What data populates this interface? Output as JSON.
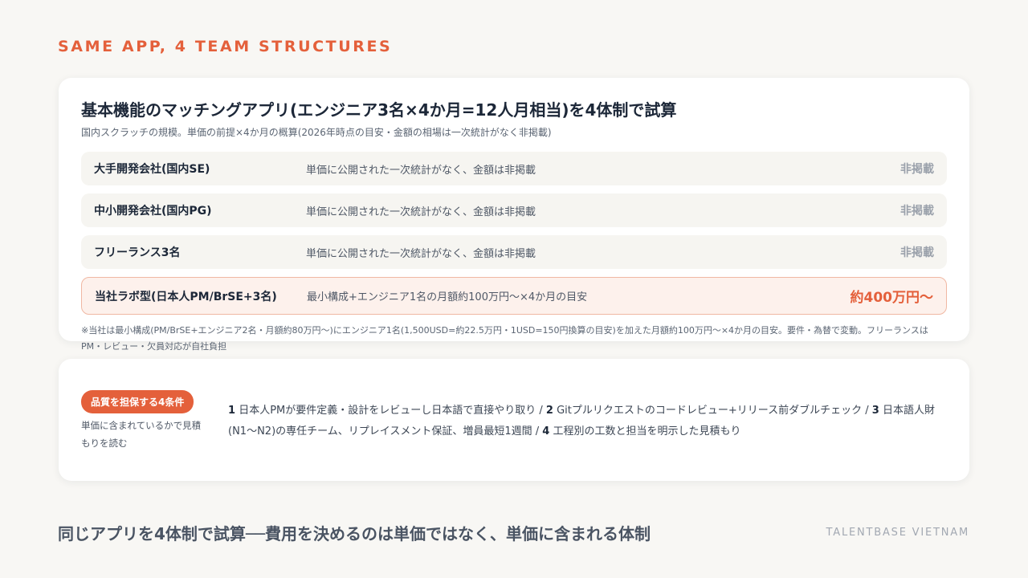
{
  "eyebrow": "SAME APP, 4 TEAM STRUCTURES",
  "main": {
    "title": "基本機能のマッチングアプリ(エンジニア3名×4か月=12人月相当)を4体制で試算",
    "subtitle": "国内スクラッチの規模。単価の前提×4か月の概算(2026年時点の目安・金額の相場は一次統計がなく非掲載)",
    "rows": [
      {
        "name": "大手開発会社(国内SE)",
        "desc": "単価に公開された一次統計がなく、金額は非掲載",
        "value": "非掲載"
      },
      {
        "name": "中小開発会社(国内PG)",
        "desc": "単価に公開された一次統計がなく、金額は非掲載",
        "value": "非掲載"
      },
      {
        "name": "フリーランス3名",
        "desc": "単価に公開された一次統計がなく、金額は非掲載",
        "value": "非掲載"
      },
      {
        "name": "当社ラボ型(日本人PM/BrSE+3名)",
        "desc": "最小構成+エンジニア1名の月額約100万円〜×4か月の目安",
        "value": "約400万円〜"
      }
    ],
    "footnote": "※当社は最小構成(PM/BrSE+エンジニア2名・月額約80万円〜)にエンジニア1名(1,500USD=約22.5万円・1USD=150円換算の目安)を加えた月額約100万円〜×4か月の目安。要件・為替で変動。フリーランスはPM・レビュー・欠員対応が自社負担"
  },
  "quality": {
    "badge": "品質を担保する4条件",
    "note": "単価に含まれているかで見積もりを読む",
    "conditions": [
      {
        "num": "1",
        "text": "日本人PMが要件定義・設計をレビューし日本語で直接やり取り"
      },
      {
        "num": "2",
        "text": "Gitプルリクエストのコードレビュー+リリース前ダブルチェック"
      },
      {
        "num": "3",
        "text": "日本語人財(N1〜N2)の専任チーム、リプレイスメント保証、増員最短1週間"
      },
      {
        "num": "4",
        "text": "工程別の工数と担当を明示した見積もり"
      }
    ],
    "separator": " / "
  },
  "footer": {
    "title": "同じアプリを4体制で試算──費用を決めるのは単価ではなく、単価に含まれる体制",
    "brand": "TALENTBASE VIETNAM"
  },
  "colors": {
    "accent": "#e4603b",
    "background": "#f8f7f4",
    "muted": "#9aa1ab"
  }
}
